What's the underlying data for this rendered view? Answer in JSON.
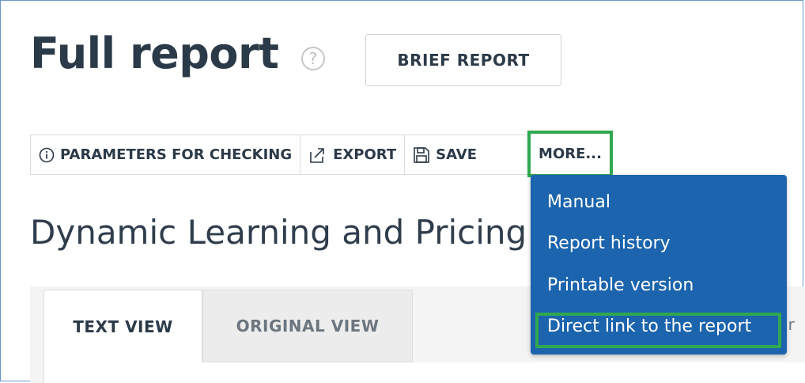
{
  "header": {
    "title": "Full report",
    "help_icon": "question-circle-icon",
    "help_glyph": "?",
    "brief_report_label": "BRIEF REPORT"
  },
  "toolbar": {
    "parameters_label": "PARAMETERS FOR CHECKING",
    "parameters_icon": "info-circle-icon",
    "export_label": "EXPORT",
    "export_icon": "export-icon",
    "save_label": "SAVE",
    "save_icon": "floppy-disk-icon",
    "more_label": "MORE..."
  },
  "document": {
    "title": "Dynamic Learning and Pricing"
  },
  "tabs": [
    {
      "label": "TEXT VIEW",
      "active": true
    },
    {
      "label": "ORIGINAL VIEW",
      "active": false
    }
  ],
  "clipped_text": "ur",
  "more_menu": {
    "items": [
      {
        "label": "Manual"
      },
      {
        "label": "Report history"
      },
      {
        "label": "Printable version"
      },
      {
        "label": "Direct link to the report",
        "highlighted": true
      }
    ]
  },
  "colors": {
    "menu_background": "#1c64ad",
    "highlight_outline": "#2fa84f",
    "heading_text": "#2b3a48"
  }
}
